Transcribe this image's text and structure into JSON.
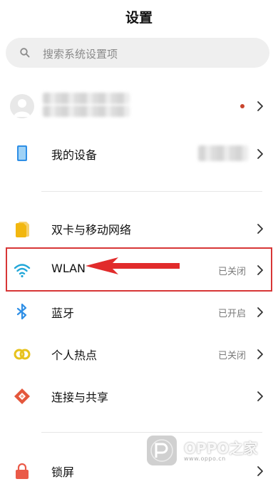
{
  "header": {
    "title": "设置"
  },
  "search": {
    "placeholder": "搜索系统设置项",
    "icon": "search-icon"
  },
  "profile": {
    "notification_dot_color": "#c9452d"
  },
  "device": {
    "label": "我的设备",
    "icon": "phone-icon"
  },
  "items": [
    {
      "label": "双卡与移动网络",
      "status": "",
      "icon": "sim-card-icon",
      "color": "#f2b70f"
    },
    {
      "label": "WLAN",
      "status": "已关闭",
      "icon": "wifi-icon",
      "color": "#22a7d8"
    },
    {
      "label": "蓝牙",
      "status": "已开启",
      "icon": "bluetooth-icon",
      "color": "#2f8fe6"
    },
    {
      "label": "个人热点",
      "status": "已关闭",
      "icon": "hotspot-icon",
      "color": "#e7c21c"
    },
    {
      "label": "连接与共享",
      "status": "",
      "icon": "connection-share-icon",
      "color": "#e4573c"
    },
    {
      "label": "锁屏",
      "status": "",
      "icon": "lock-icon",
      "color": "#ea5a48"
    }
  ],
  "annotation": {
    "highlight_color": "#d73636"
  },
  "watermark": {
    "text": "OPPO之家",
    "sub": "www.oppo.cn",
    "icon": "oppo-logo-icon"
  }
}
